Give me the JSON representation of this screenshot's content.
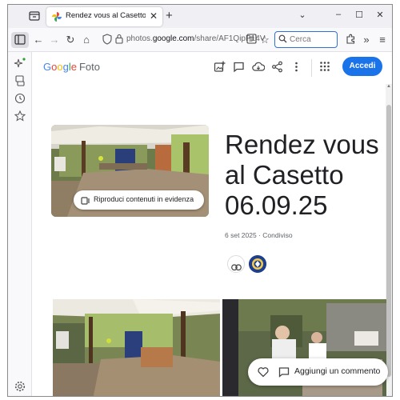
{
  "browser": {
    "tab": {
      "title": "Rendez vous al Casetto 06.09.25"
    },
    "url": {
      "prefix": "photos.",
      "domain": "google.com",
      "path": "/share/AF1QipP14V"
    },
    "search": {
      "placeholder": "Cerca"
    }
  },
  "header": {
    "logo": {
      "g1": "G",
      "o1": "o",
      "o2": "o",
      "g2": "g",
      "l": "l",
      "e": "e",
      "product": "Foto"
    },
    "signin_label": "Accedi"
  },
  "album": {
    "title": "Rendez vous al Casetto 06.09.25",
    "meta": "6 set 2025 · Condiviso",
    "highlight_button": "Riproduci contenuti in evidenza"
  },
  "footer_actions": {
    "comment_label": "Aggiungi un commento"
  },
  "colors": {
    "accent": "#1a73e8",
    "search_border": "#2f6fd6"
  }
}
